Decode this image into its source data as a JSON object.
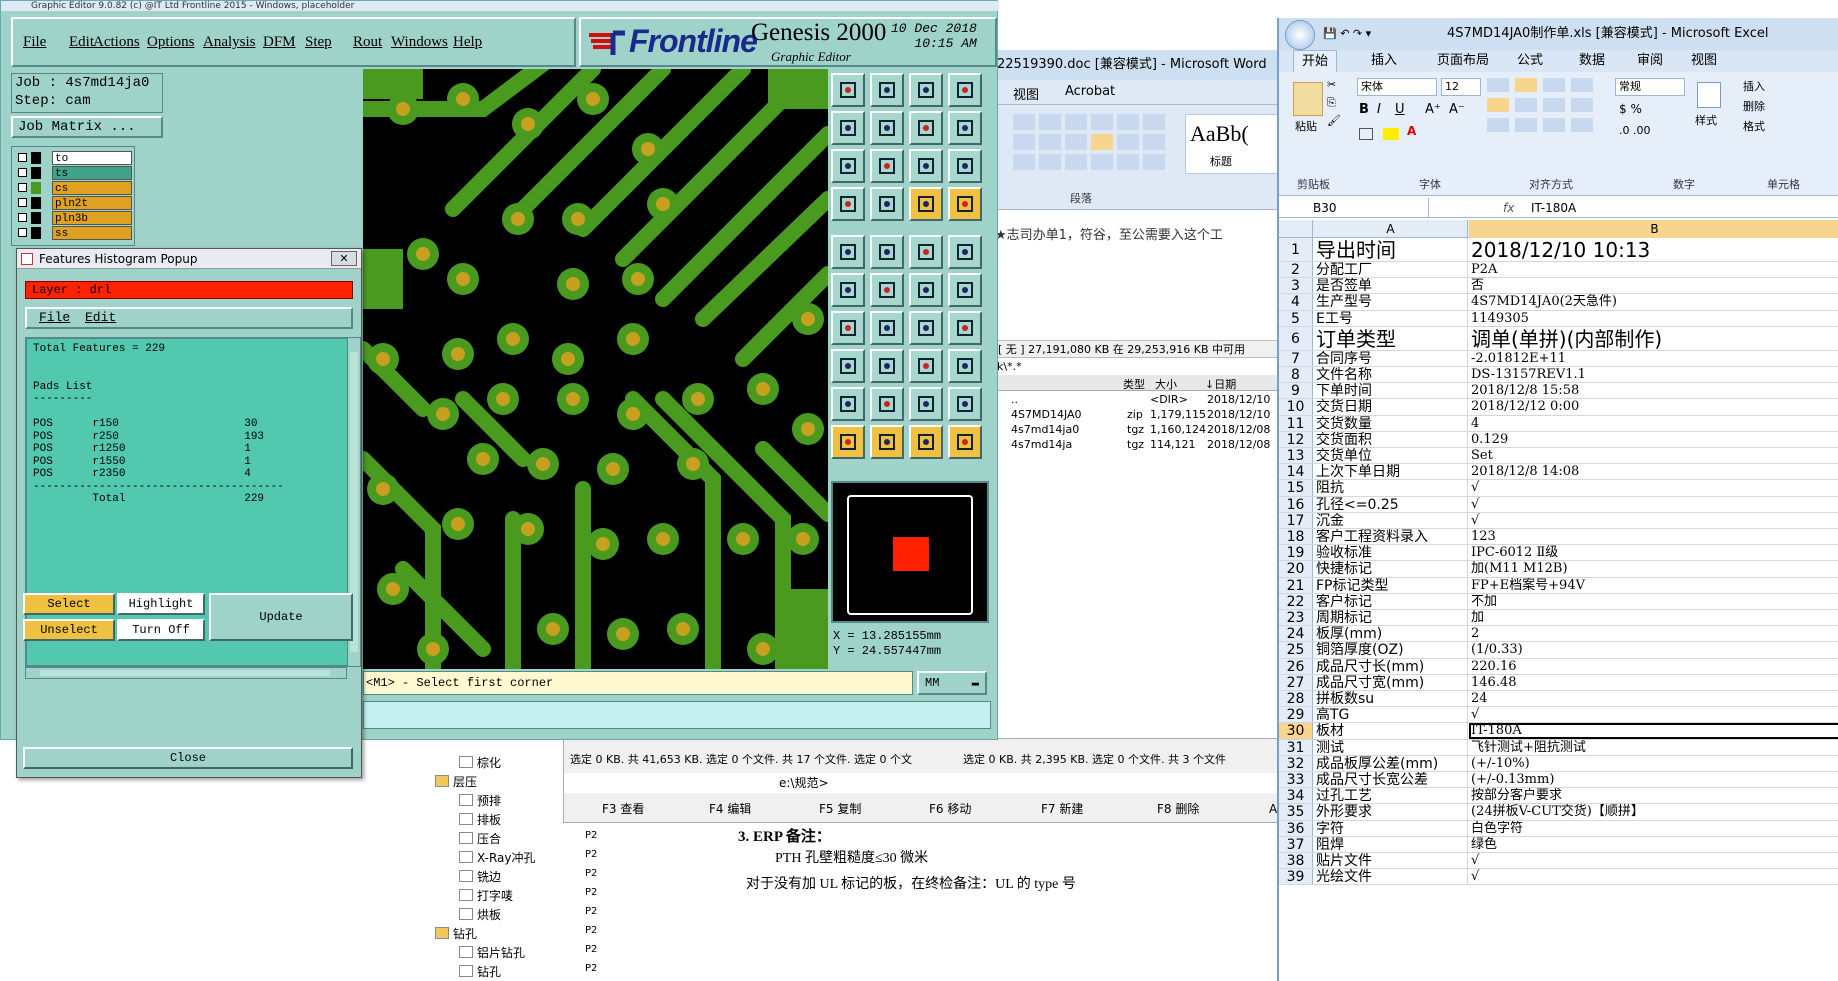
{
  "genesis": {
    "window_title": "Graphic Editor 9.0.82 (c) @IT Ltd Frontline 2015 - Windows, placeholder",
    "menu": [
      "File",
      "Edit",
      "Actions",
      "Options",
      "Analysis",
      "DFM",
      "Step",
      "Rout",
      "Windows",
      "Help"
    ],
    "logo": "Frontline",
    "product": "Genesis 2000",
    "product_sub": "Graphic Editor",
    "date": "10 Dec 2018",
    "time": "10:15 AM",
    "job_label": "Job : 4s7md14ja0",
    "step_label": "Step: cam",
    "job_matrix": "Job Matrix ...",
    "layers": [
      {
        "name": "to",
        "color": "#ffffff",
        "swatch": "#000000"
      },
      {
        "name": "ts",
        "color": "#3fa38a",
        "swatch": "#000000"
      },
      {
        "name": "cs",
        "color": "#e0a020",
        "swatch": "#4a9a20"
      },
      {
        "name": "pln2t",
        "color": "#e0a020",
        "swatch": "#000000"
      },
      {
        "name": "pln3b",
        "color": "#e0a020",
        "swatch": "#000000"
      },
      {
        "name": "ss",
        "color": "#e0a020",
        "swatch": "#000000"
      }
    ],
    "coord_x": "X = 13.285155mm",
    "coord_y": "Y = 24.557447mm",
    "status": "<M1> - Select first corner",
    "units": "MM"
  },
  "popup": {
    "title": "Features Histogram Popup",
    "close": "✕",
    "layer": "Layer :  drl",
    "menu_file": "File",
    "menu_edit": "Edit",
    "text": "Total Features = 229\n\n\nPads List\n---------\n\nPOS      r150                   30\nPOS      r250                   193\nPOS      r1250                  1\nPOS      r1550                  1\nPOS      r2350                  4\n--------------------------------------\n         Total                  229",
    "btn_select": "Select",
    "btn_highlight": "Highlight",
    "btn_unselect": "Unselect",
    "btn_turnoff": "Turn Off",
    "btn_update": "Update",
    "btn_close": "Close"
  },
  "word": {
    "title": "22519390.doc [兼容模式] - Microsoft Word",
    "tab_view": "视图",
    "tab_acrobat": "Acrobat",
    "style_sample": "AaBb(",
    "style_name": "标题",
    "group_paragraph": "段落",
    "doc_line1": "3. ERP 备注：",
    "doc_line2": "PTH 孔壁粗糙度≤30 微米",
    "doc_line3": "对于没有加 UL 标记的板，在终检备注：UL 的 type 号"
  },
  "explorer": {
    "disk_info": "[ 无 ]  27,191,080 KB 在 29,253,916 KB 中可用",
    "path": "k\\*.*",
    "col_type": "类型",
    "col_size": "大小",
    "col_date": "↓日期",
    "files": [
      {
        "name": "..",
        "type": "",
        "size": "<DIR>",
        "date": "2018/12/10"
      },
      {
        "name": "4S7MD14JA0",
        "type": "zip",
        "size": "1,179,115",
        "date": "2018/12/10"
      },
      {
        "name": "4s7md14ja0",
        "type": "tgz",
        "size": "1,160,124",
        "date": "2018/12/08"
      },
      {
        "name": "4s7md14ja",
        "type": "tgz",
        "size": "114,121",
        "date": "2018/12/08"
      }
    ],
    "status_left": "选定 0 KB. 共 41,653 KB. 选定 0 个文件. 共 17 个文件. 选定 0 个文",
    "status_right": "选定 0 KB. 共 2,395 KB. 选定 0 个文件. 共 3 个文件",
    "cmd": "e:\\规范>",
    "fkeys": [
      "F3 查看",
      "F4 编辑",
      "F5 复制",
      "F6 移动",
      "F7 新建",
      "F8 删除",
      "Alt"
    ],
    "tree": [
      {
        "label": "棕化",
        "indent": 2,
        "code": ""
      },
      {
        "label": "层压",
        "indent": 1,
        "code": ""
      },
      {
        "label": "预排",
        "indent": 2,
        "code": "P2"
      },
      {
        "label": "排板",
        "indent": 2,
        "code": "P2"
      },
      {
        "label": "压合",
        "indent": 2,
        "code": "P2"
      },
      {
        "label": "X-Ray冲孔",
        "indent": 2,
        "code": "P2"
      },
      {
        "label": "铣边",
        "indent": 2,
        "code": "P2"
      },
      {
        "label": "打字唛",
        "indent": 2,
        "code": "P2"
      },
      {
        "label": "烘板",
        "indent": 2,
        "code": "P2"
      },
      {
        "label": "钻孔",
        "indent": 1,
        "code": "P2"
      },
      {
        "label": "铝片钻孔",
        "indent": 2,
        "code": "P2"
      },
      {
        "label": "钻孔",
        "indent": 2,
        "code": "P2"
      }
    ],
    "tree_top": "棕化"
  },
  "excel": {
    "title": "4S7MD14JA0制作单.xls [兼容模式] - Microsoft Excel",
    "tabs": [
      "开始",
      "插入",
      "页面布局",
      "公式",
      "数据",
      "审阅",
      "视图"
    ],
    "font_name": "宋体",
    "font_size": "12",
    "number_format": "常规",
    "paste": "粘贴",
    "styles": "样式",
    "insert": "插入",
    "delete": "删除",
    "format": "格式",
    "groups": [
      "剪贴板",
      "字体",
      "对齐方式",
      "数字",
      "单元格"
    ],
    "name_box": "B30",
    "fx": "fx",
    "formula": "IT-180A",
    "col_a": "A",
    "col_b": "B",
    "rows": [
      {
        "n": "1",
        "a": "导出时间",
        "b": "2018/12/10  10:13",
        "big": true
      },
      {
        "n": "2",
        "a": "分配工厂",
        "b": "P2A"
      },
      {
        "n": "3",
        "a": "是否签单",
        "b": "否"
      },
      {
        "n": "4",
        "a": "生产型号",
        "b": "4S7MD14JA0(2天急件)"
      },
      {
        "n": "5",
        "a": "E工号",
        "b": "1149305"
      },
      {
        "n": "6",
        "a": "订单类型",
        "b": "调单(单拼)(内部制作)",
        "big": true
      },
      {
        "n": "7",
        "a": "合同序号",
        "b": "-2.01812E+11"
      },
      {
        "n": "8",
        "a": "文件名称",
        "b": "DS-13157REV1.1"
      },
      {
        "n": "9",
        "a": "下单时间",
        "b": "2018/12/8 15:58"
      },
      {
        "n": "10",
        "a": "交货日期",
        "b": "2018/12/12 0:00"
      },
      {
        "n": "11",
        "a": "交货数量",
        "b": "4"
      },
      {
        "n": "12",
        "a": "交货面积",
        "b": "0.129"
      },
      {
        "n": "13",
        "a": "交货单位",
        "b": "Set"
      },
      {
        "n": "14",
        "a": "上次下单日期",
        "b": "2018/12/8 14:08"
      },
      {
        "n": "15",
        "a": "阻抗",
        "b": "√"
      },
      {
        "n": "16",
        "a": "孔径<=0.25",
        "b": "√"
      },
      {
        "n": "17",
        "a": "沉金",
        "b": "√"
      },
      {
        "n": "18",
        "a": "客户工程资料录入",
        "b": "123"
      },
      {
        "n": "19",
        "a": "验收标准",
        "b": "IPC-6012 Ⅱ级"
      },
      {
        "n": "20",
        "a": "快捷标记",
        "b": "加(M11 M12B)"
      },
      {
        "n": "21",
        "a": "FP标记类型",
        "b": "FP+E档案号+94V"
      },
      {
        "n": "22",
        "a": "客户标记",
        "b": "不加"
      },
      {
        "n": "23",
        "a": "周期标记",
        "b": "加"
      },
      {
        "n": "24",
        "a": "板厚(mm)",
        "b": "2"
      },
      {
        "n": "25",
        "a": "铜箔厚度(OZ)",
        "b": "(1/0.33)"
      },
      {
        "n": "26",
        "a": "成品尺寸长(mm)",
        "b": "220.16"
      },
      {
        "n": "27",
        "a": "成品尺寸宽(mm)",
        "b": "146.48"
      },
      {
        "n": "28",
        "a": "拼板数su",
        "b": "24"
      },
      {
        "n": "29",
        "a": "高TG",
        "b": "√"
      },
      {
        "n": "30",
        "a": "板材",
        "b": "IT-180A",
        "sel": true
      },
      {
        "n": "31",
        "a": "测试",
        "b": "飞针测试+阻抗测试"
      },
      {
        "n": "32",
        "a": "成品板厚公差(mm)",
        "b": "(+/-10%)"
      },
      {
        "n": "33",
        "a": "成品尺寸长宽公差",
        "b": "(+/-0.13mm)"
      },
      {
        "n": "34",
        "a": "过孔工艺",
        "b": "按部分客户要求"
      },
      {
        "n": "35",
        "a": "外形要求",
        "b": "(24拼板V-CUT交货)【顺拼】"
      },
      {
        "n": "36",
        "a": "字符",
        "b": "白色字符"
      },
      {
        "n": "37",
        "a": "阻焊",
        "b": "绿色"
      },
      {
        "n": "38",
        "a": "贴片文件",
        "b": "√"
      },
      {
        "n": "39",
        "a": "光绘文件",
        "b": "√"
      }
    ]
  }
}
